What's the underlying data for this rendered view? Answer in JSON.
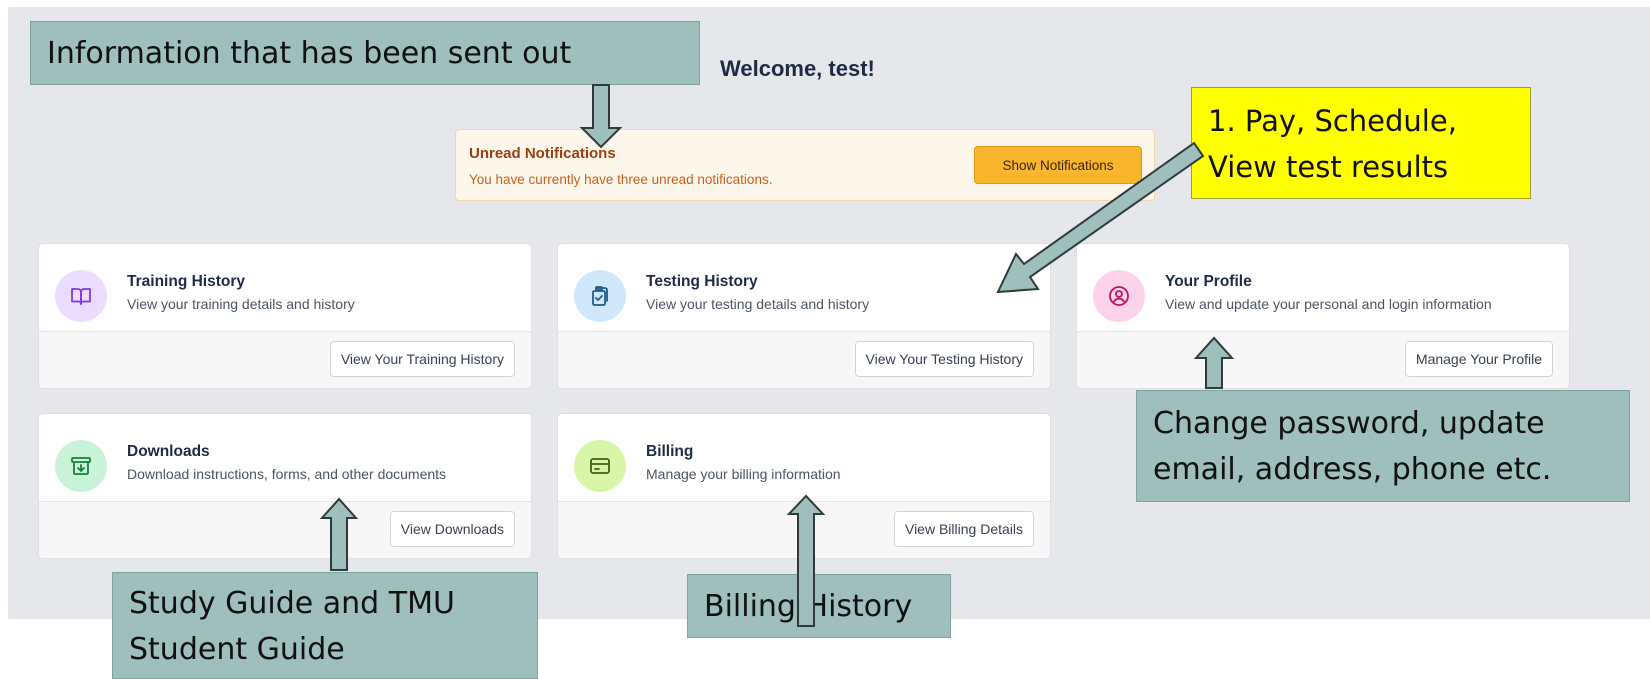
{
  "welcome": "Welcome, test!",
  "notifications": {
    "title": "Unread Notifications",
    "text": "You have currently have three unread notifications.",
    "button": "Show Notifications"
  },
  "cards": {
    "training": {
      "title": "Training History",
      "desc": "View your training details and history",
      "button": "View Your Training History",
      "icon": "book-icon"
    },
    "testing": {
      "title": "Testing History",
      "desc": "View your testing details and history",
      "button": "View Your Testing History",
      "icon": "clipboard-check-icon"
    },
    "profile": {
      "title": "Your Profile",
      "desc": "View and update your personal and login information",
      "button": "Manage Your Profile",
      "icon": "user-circle-icon"
    },
    "downloads": {
      "title": "Downloads",
      "desc": "Download instructions, forms, and other documents",
      "button": "View Downloads",
      "icon": "archive-download-icon"
    },
    "billing": {
      "title": "Billing",
      "desc": "Manage your billing information",
      "button": "View Billing Details",
      "icon": "credit-card-icon"
    }
  },
  "callouts": {
    "info": "Information that has been sent out",
    "pay": "1. Pay, Schedule, View test results",
    "password": "Change password, update email, address, phone etc.",
    "study": "Study Guide and TMU Student Guide",
    "billing": "Billing History"
  },
  "colors": {
    "background": "#e6e7ea",
    "callout": "#9fbfbd",
    "callout_highlight": "#ffff00",
    "notification_button": "#f9b52b"
  }
}
